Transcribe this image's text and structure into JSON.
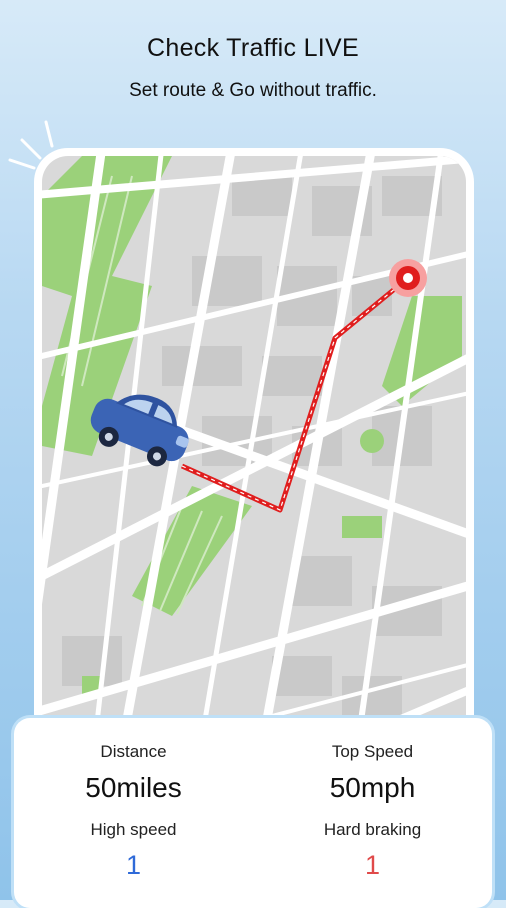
{
  "header": {
    "title": "Check Traffic LIVE",
    "subtitle": "Set route & Go without traffic."
  },
  "stats": {
    "distance_label": "Distance",
    "distance_value": "50miles",
    "top_speed_label": "Top Speed",
    "top_speed_value": "50mph",
    "high_speed_label": "High speed",
    "high_speed_value": "1",
    "hard_braking_label": "Hard braking",
    "hard_braking_value": "1"
  },
  "colors": {
    "route": "#e01e1e",
    "car": "#3b64b5",
    "park": "#9bd17a",
    "high_speed_value": "#2f6ad8",
    "hard_braking_value": "#e04a4a"
  }
}
